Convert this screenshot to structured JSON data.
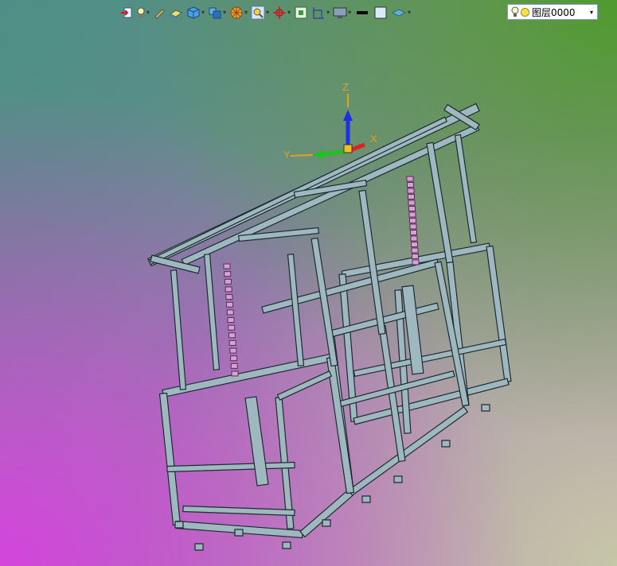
{
  "toolbar": {
    "buttons": [
      {
        "icon": "import-icon",
        "dropdown": false
      },
      {
        "icon": "light-icon",
        "dropdown": true
      },
      {
        "icon": "pen-icon",
        "dropdown": false
      },
      {
        "icon": "eraser-icon",
        "dropdown": false
      },
      {
        "icon": "cube-icon",
        "dropdown": true
      },
      {
        "icon": "box-view-icon",
        "dropdown": true
      },
      {
        "icon": "render-wheel-icon",
        "dropdown": true
      },
      {
        "icon": "zoom-icon",
        "dropdown": true
      },
      {
        "icon": "orbit-icon",
        "dropdown": true
      },
      {
        "icon": "grid-icon",
        "dropdown": false
      },
      {
        "icon": "frame-icon",
        "dropdown": true
      },
      {
        "icon": "display-icon",
        "dropdown": true
      },
      {
        "icon": "line-weight-icon",
        "dropdown": false
      },
      {
        "icon": "color-box-icon",
        "dropdown": false
      },
      {
        "icon": "layer-plane-icon",
        "dropdown": true
      }
    ]
  },
  "layer": {
    "name": "图层0000",
    "color": "#f4e34a"
  },
  "axes": {
    "x": "X",
    "y": "Y",
    "z": "Z"
  },
  "colors": {
    "frame": "#9fb8c0",
    "frameEdge": "#1b2b30",
    "chain": "#d9a0d6",
    "triadX": "#e02020",
    "triadY": "#20c020",
    "triadZ": "#2030e0"
  }
}
